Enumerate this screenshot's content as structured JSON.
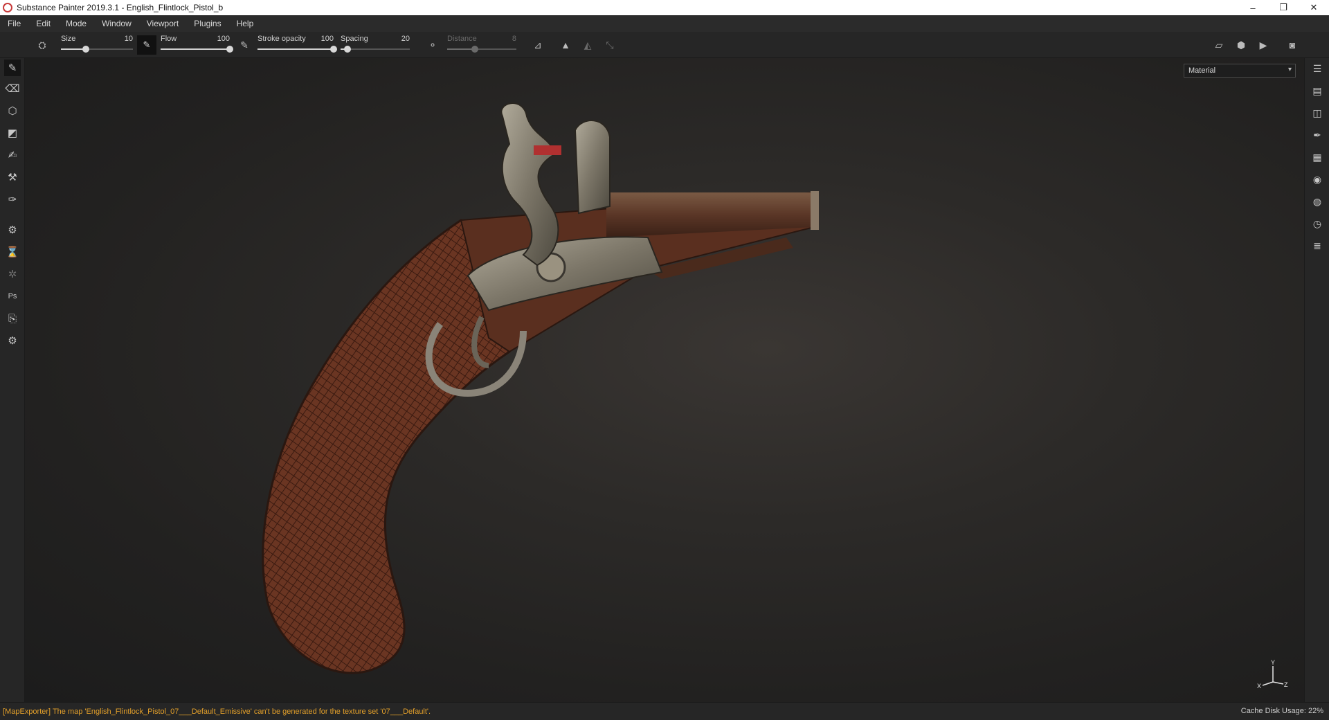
{
  "window": {
    "title": "Substance Painter 2019.3.1 - English_Flintlock_Pistol_b",
    "controls": {
      "minimize": "–",
      "restore": "❐",
      "close": "✕"
    }
  },
  "menubar": {
    "items": [
      "File",
      "Edit",
      "Mode",
      "Window",
      "Viewport",
      "Plugins",
      "Help"
    ]
  },
  "toolbar": {
    "size": {
      "label": "Size",
      "value": "10",
      "level": 0.35
    },
    "flow": {
      "label": "Flow",
      "value": "100",
      "level": 1.0
    },
    "stroke_opacity": {
      "label": "Stroke opacity",
      "value": "100",
      "level": 1.0
    },
    "spacing": {
      "label": "Spacing",
      "value": "20",
      "level": 0.1
    },
    "distance": {
      "label": "Distance",
      "value": "8",
      "level": 0.4
    }
  },
  "left_tools": [
    {
      "name": "paint-brush",
      "glyph": "✎"
    },
    {
      "name": "eraser",
      "glyph": "⌫"
    },
    {
      "name": "projection",
      "glyph": "⬡"
    },
    {
      "name": "polygon-fill",
      "glyph": "◩"
    },
    {
      "name": "smudge",
      "glyph": "✍"
    },
    {
      "name": "clone-stamp",
      "glyph": "⚒"
    },
    {
      "name": "color-picker",
      "glyph": "✑"
    },
    {
      "name": "bake",
      "glyph": "⚙"
    },
    {
      "name": "iray",
      "glyph": "⌛"
    },
    {
      "name": "geometry-mask",
      "glyph": "✲"
    },
    {
      "name": "photoshop",
      "glyph": "Ps"
    },
    {
      "name": "export",
      "glyph": "⎘"
    },
    {
      "name": "settings",
      "glyph": "⚙"
    }
  ],
  "right_panel": [
    {
      "name": "layers-panel",
      "glyph": "☰"
    },
    {
      "name": "texture-set-list",
      "glyph": "▤"
    },
    {
      "name": "texture-set-settings",
      "glyph": "◫"
    },
    {
      "name": "properties",
      "glyph": "✒"
    },
    {
      "name": "display-settings",
      "glyph": "▦"
    },
    {
      "name": "viewer-settings",
      "glyph": "◉"
    },
    {
      "name": "shelf",
      "glyph": "◍"
    },
    {
      "name": "history",
      "glyph": "◷"
    },
    {
      "name": "log",
      "glyph": "≣"
    }
  ],
  "viewport": {
    "mode_select": "Material",
    "axis": {
      "y": "Y",
      "x": "X",
      "z": "Z"
    }
  },
  "status": {
    "message": "[MapExporter] The map 'English_Flintlock_Pistol_07___Default_Emissive' can't be generated for the texture set '07___Default'.",
    "cache": "Cache Disk Usage:",
    "cache_value": "22%"
  },
  "colors": {
    "warning": "#e5a12a",
    "wood": "#5a2e1c",
    "metal": "#8a8578"
  }
}
